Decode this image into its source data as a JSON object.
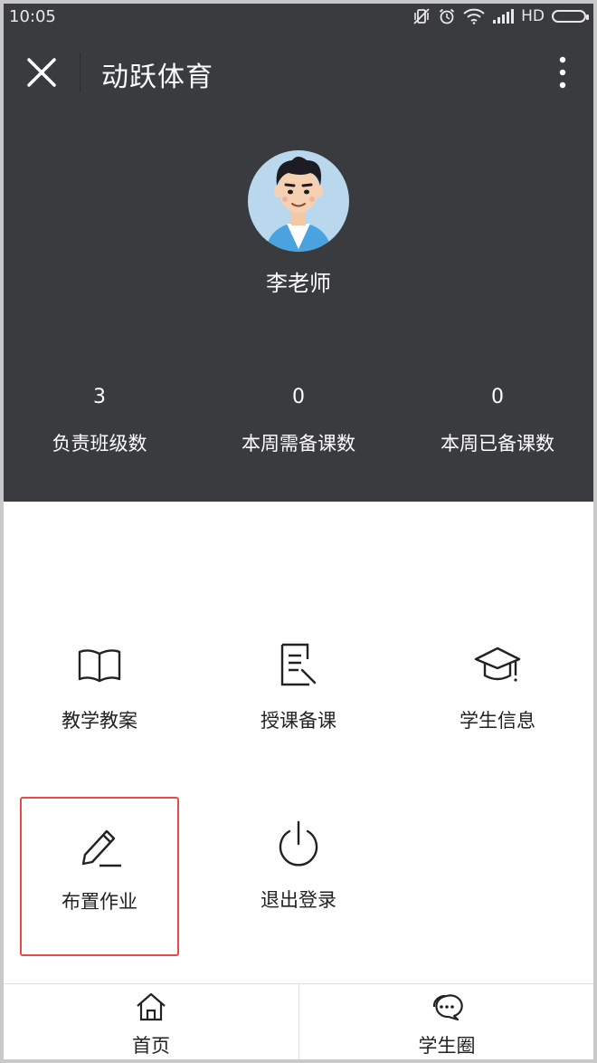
{
  "status_bar": {
    "time": "10:05",
    "network_label": "HD"
  },
  "app": {
    "title": "动跃体育"
  },
  "profile": {
    "name": "李老师"
  },
  "stats": [
    {
      "value": "3",
      "label": "负责班级数"
    },
    {
      "value": "0",
      "label": "本周需备课数"
    },
    {
      "value": "0",
      "label": "本周已备课数"
    }
  ],
  "menu": [
    {
      "label": "教学教案",
      "icon": "book-icon"
    },
    {
      "label": "授课备课",
      "icon": "document-edit-icon"
    },
    {
      "label": "学生信息",
      "icon": "graduation-cap-icon"
    },
    {
      "label": "布置作业",
      "icon": "pencil-icon",
      "highlighted": true
    },
    {
      "label": "退出登录",
      "icon": "power-icon"
    }
  ],
  "tabs": [
    {
      "label": "首页",
      "icon": "home-icon"
    },
    {
      "label": "学生圈",
      "icon": "chat-bubbles-icon"
    }
  ],
  "colors": {
    "header_bg": "#3a3b3f",
    "highlight_border": "#e84a4a",
    "text": "#222222"
  }
}
